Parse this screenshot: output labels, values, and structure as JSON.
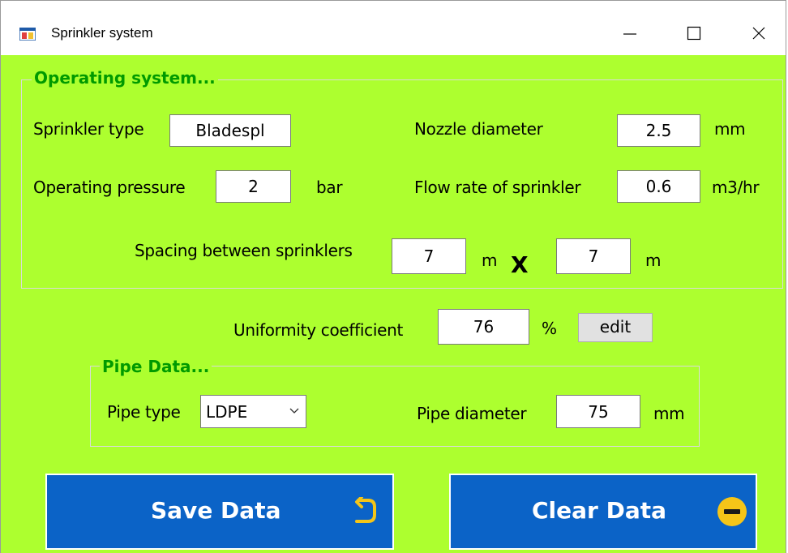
{
  "window": {
    "title": "Sprinkler system",
    "background": "#adff2f"
  },
  "operating_system": {
    "group_title": "Operating system...",
    "sprinkler_type_label": "Sprinkler type",
    "sprinkler_type_value": "Bladespl",
    "nozzle_diameter_label": "Nozzle diameter",
    "nozzle_diameter_value": "2.5",
    "nozzle_diameter_unit": "mm",
    "operating_pressure_label": "Operating pressure",
    "operating_pressure_value": "2",
    "operating_pressure_unit": "bar",
    "flow_rate_label": "Flow rate of sprinkler",
    "flow_rate_value": "0.6",
    "flow_rate_unit": "m3/hr",
    "spacing_label": "Spacing between sprinklers",
    "spacing_value_1": "7",
    "spacing_unit_1": "m",
    "spacing_times": "X",
    "spacing_value_2": "7",
    "spacing_unit_2": "m"
  },
  "uniformity": {
    "label": "Uniformity coefficient",
    "value": "76",
    "unit": "%",
    "edit_label": "edit"
  },
  "pipe_data": {
    "group_title": "Pipe Data...",
    "pipe_type_label": "Pipe type",
    "pipe_type_value": "LDPE",
    "pipe_diameter_label": "Pipe diameter",
    "pipe_diameter_value": "75",
    "pipe_diameter_unit": "mm"
  },
  "actions": {
    "save_label": "Save Data",
    "clear_label": "Clear Data",
    "button_color": "#0b63c7",
    "icon_color": "#f5c518"
  },
  "icons": {
    "app": "app-window-icon",
    "save": "undo-arrow-icon",
    "clear": "minus-circle-icon"
  }
}
